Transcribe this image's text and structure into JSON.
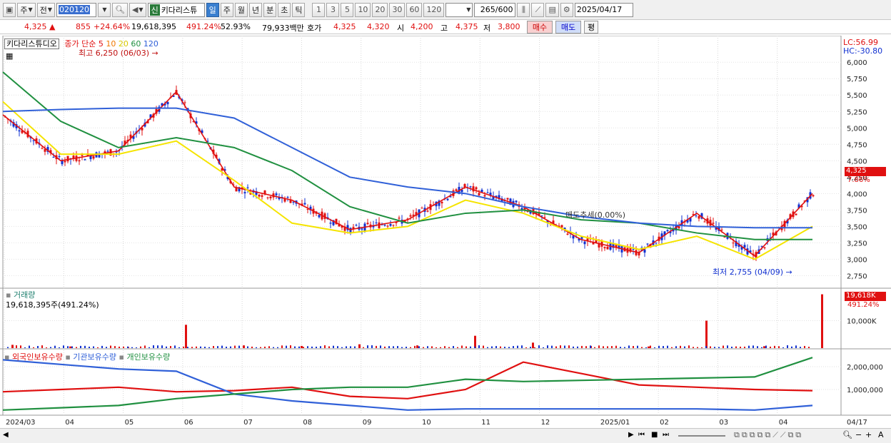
{
  "toolbar": {
    "period_select": "주",
    "market_select": "전",
    "code_value": "020120",
    "stock_name": "키다리스튜",
    "new_badge": "신",
    "tabs": [
      "일",
      "주",
      "월",
      "년",
      "분",
      "초",
      "틱"
    ],
    "active_tab": "일",
    "intervals": [
      "1",
      "3",
      "5",
      "10",
      "20",
      "30",
      "60",
      "120"
    ],
    "count_value": "265",
    "count_total": "/600",
    "date_value": "2025/04/17"
  },
  "quote": {
    "price": "4,325 ▲",
    "change": "855",
    "change_pct": "+24.64%",
    "volume": "19,618,395",
    "volume_pct": "491.24%",
    "turnover": "52.93%",
    "amount": "79,933백만",
    "hoga_label": "호가",
    "ask": "4,325",
    "bid": "4,320",
    "open_label": "시",
    "open": "4,200",
    "high_label": "고",
    "high": "4,375",
    "low_label": "저",
    "low": "3,800",
    "buy_label": "매수",
    "sell_label": "매도",
    "eval_label": "평"
  },
  "price_panel": {
    "stock_label": "키다리스튜디오",
    "ma_label": "종가 단순",
    "ma_periods": [
      "5",
      "10",
      "20",
      "60",
      "120"
    ],
    "high_note": "최고 6,250 (06/03) →",
    "low_note": "최저 2,755 (04/09) →",
    "lc_label": "LC:56.99",
    "hc_label": "HC:-30.80",
    "last_price_tag": "4,325",
    "last_pct_tag": "7.86%",
    "mid_annotation": "매도추세(0.00%)",
    "y_ticks": [
      "6,000",
      "5,750",
      "5,500",
      "5,250",
      "5,000",
      "4,750",
      "4,500",
      "4,250",
      "4,000",
      "3,750",
      "3,500",
      "3,250",
      "3,000",
      "2,750"
    ]
  },
  "volume_panel": {
    "title": "거래량",
    "readout": "19,618,395주(491.24%)",
    "tag_value": "19,618K",
    "tag_pct": "491.24%",
    "y_ticks": [
      "10,000K"
    ]
  },
  "holder_panel": {
    "legend": [
      "외국인보유수량",
      "기관보유수량",
      "개인보유수량"
    ],
    "y_ticks": [
      "2,000,000",
      "1,000,000"
    ]
  },
  "x_axis": {
    "labels": [
      "2024/03",
      "04",
      "05",
      "06",
      "07",
      "08",
      "09",
      "10",
      "11",
      "12",
      "2025/01",
      "02",
      "03",
      "04"
    ],
    "right_label": "04/17"
  },
  "colors": {
    "ma5": "#e01010",
    "ma10": "#f07800",
    "ma20": "#f5e400",
    "ma60": "#209040",
    "ma120": "#3060d8",
    "candle_up": "#e01010",
    "candle_down": "#1030d0",
    "foreign": "#e01010",
    "institution": "#3060d8",
    "individual": "#209040"
  },
  "chart_data": {
    "type": "line",
    "title": "",
    "x": [
      "2024/03",
      "04",
      "05",
      "06",
      "07",
      "08",
      "09",
      "10",
      "11",
      "12",
      "2025/01",
      "02",
      "03",
      "04"
    ],
    "ylim": [
      2700,
      6100
    ],
    "series": [
      {
        "name": "5",
        "values": [
          5200,
          4500,
          4650,
          5550,
          4100,
          3900,
          3450,
          3600,
          4100,
          3800,
          3300,
          3100,
          3700,
          3050,
          4000
        ]
      },
      {
        "name": "20",
        "values": [
          5400,
          4600,
          4600,
          4800,
          4200,
          3550,
          3400,
          3500,
          3900,
          3700,
          3350,
          3150,
          3350,
          3000,
          3500
        ]
      },
      {
        "name": "60",
        "values": [
          5850,
          5100,
          4700,
          4850,
          4700,
          4350,
          3800,
          3550,
          3700,
          3750,
          3600,
          3550,
          3400,
          3300,
          3300
        ]
      },
      {
        "name": "120",
        "values": [
          5250,
          5280,
          5300,
          5300,
          5150,
          4700,
          4250,
          4100,
          4000,
          3800,
          3650,
          3550,
          3500,
          3480,
          3480
        ]
      }
    ],
    "volume_values": [
      1.2,
      0.6,
      0.4,
      8.5,
      1.0,
      0.8,
      1.4,
      1.0,
      4.5,
      2.0,
      0.8,
      0.6,
      10.0,
      0.7,
      19.6
    ],
    "holder_series": [
      {
        "name": "외국인보유수량",
        "values": [
          900000,
          1000000,
          1100000,
          900000,
          950000,
          1100000,
          700000,
          600000,
          1000000,
          2200000,
          1700000,
          1200000,
          1100000,
          1000000,
          950000
        ]
      },
      {
        "name": "기관보유수량",
        "values": [
          2300000,
          2100000,
          1900000,
          1800000,
          800000,
          500000,
          300000,
          100000,
          150000,
          150000,
          150000,
          150000,
          150000,
          100000,
          300000
        ]
      },
      {
        "name": "개인보유수량",
        "values": [
          100000,
          200000,
          300000,
          600000,
          800000,
          1000000,
          1100000,
          1100000,
          1450000,
          1350000,
          1400000,
          1450000,
          1500000,
          1550000,
          2400000
        ]
      }
    ]
  }
}
